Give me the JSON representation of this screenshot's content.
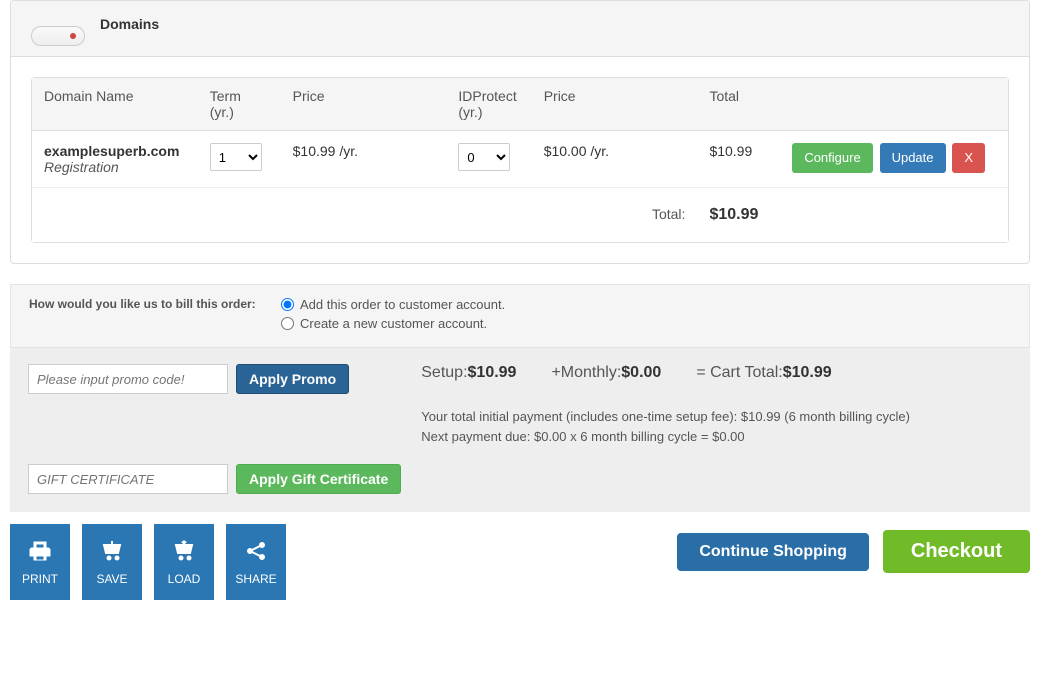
{
  "header": {
    "title": "Domains"
  },
  "columns": {
    "domain": "Domain Name",
    "term": "Term (yr.)",
    "price": "Price",
    "idprotect": "IDProtect (yr.)",
    "idprice": "Price",
    "total": "Total"
  },
  "row": {
    "domain": "examplesuperb.com",
    "type": "Registration",
    "term_value": "1",
    "price": "$10.99 /yr.",
    "idprotect_value": "0",
    "idprice": "$10.00 /yr.",
    "total": "$10.99",
    "configure": "Configure",
    "update": "Update",
    "remove": "X"
  },
  "totals": {
    "label": "Total:",
    "value": "$10.99"
  },
  "billing": {
    "question": "How would you like us to bill this order:",
    "opt_existing": "Add this order to customer account.",
    "opt_new": "Create a new customer account."
  },
  "promo": {
    "placeholder": "Please input promo code!",
    "apply": "Apply Promo",
    "gift_placeholder": "GIFT CERTIFICATE",
    "apply_gift": "Apply Gift Certificate"
  },
  "summary": {
    "setup_label": "Setup:",
    "setup_value": "$10.99",
    "monthly_label": "+Monthly:",
    "monthly_value": "$0.00",
    "cart_label": "= Cart Total:",
    "cart_value": "$10.99",
    "note1": "Your total initial payment (includes one-time setup fee): $10.99 (6 month billing cycle)",
    "note2": "Next payment due: $0.00 x 6 month billing cycle = $0.00"
  },
  "footer": {
    "print": "PRINT",
    "save": "SAVE",
    "load": "LOAD",
    "share": "SHARE",
    "continue": "Continue Shopping",
    "checkout": "Checkout"
  }
}
